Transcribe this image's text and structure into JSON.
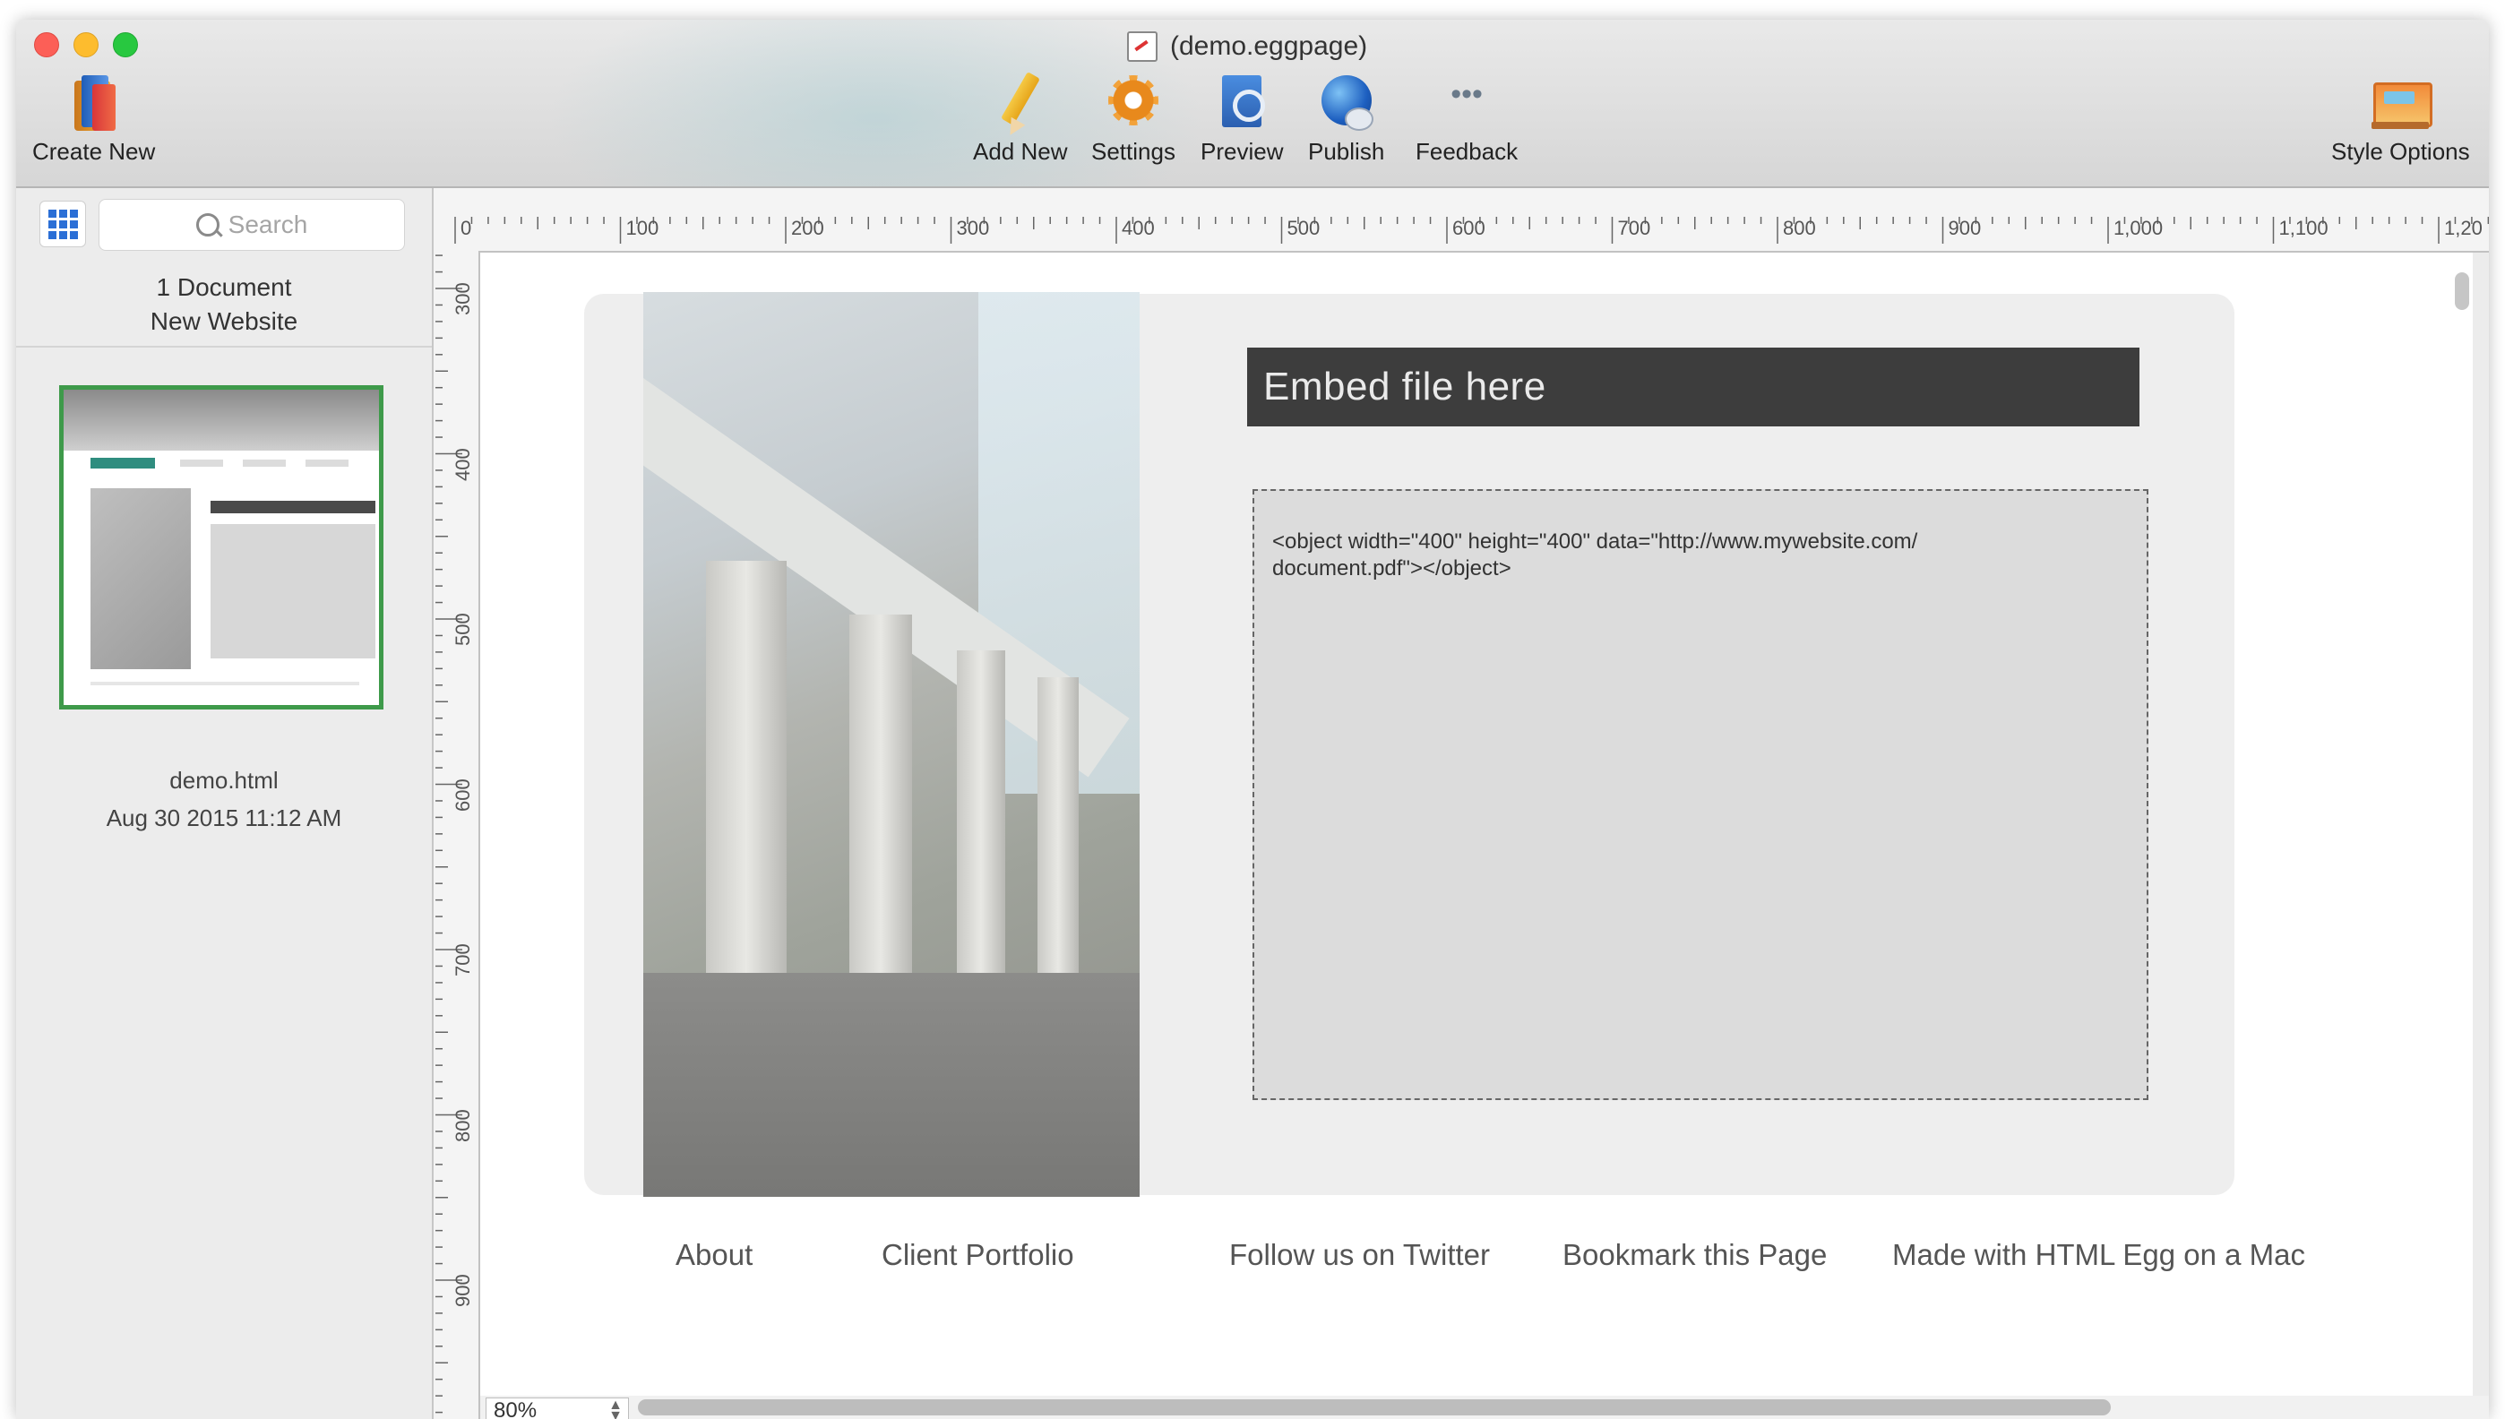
{
  "window": {
    "title": "(demo.eggpage)"
  },
  "toolbar": {
    "create_new": "Create New",
    "add_new": "Add New",
    "settings": "Settings",
    "preview": "Preview",
    "publish": "Publish",
    "feedback": "Feedback",
    "style_options": "Style Options"
  },
  "sidebar": {
    "search_placeholder": "Search",
    "document_count": "1 Document",
    "folder_name": "New Website",
    "file": {
      "name": "demo.html",
      "date": "Aug 30 2015 11:12 AM"
    }
  },
  "ruler": {
    "top_labels": [
      "0",
      "100",
      "200",
      "300",
      "400",
      "500",
      "600",
      "700",
      "800",
      "900",
      "1,000",
      "1,100",
      "1,20"
    ],
    "left_labels": [
      "300",
      "400",
      "500",
      "600",
      "700",
      "800",
      "900"
    ]
  },
  "page": {
    "embed_title": "Embed file here",
    "embed_code": "<object width=\"400\" height=\"400\" data=\"http://www.mywebsite.com/\ndocument.pdf\"></object>",
    "footer_links": [
      "About",
      "Client Portfolio",
      "Follow us on Twitter",
      "Bookmark this Page",
      "Made with HTML Egg on a Mac"
    ]
  },
  "zoom": {
    "value": "80%"
  },
  "colors": {
    "selection_border": "#3e9a4a",
    "embed_bar": "#3d3d3d",
    "nav_accent": "#2f8d7f"
  }
}
